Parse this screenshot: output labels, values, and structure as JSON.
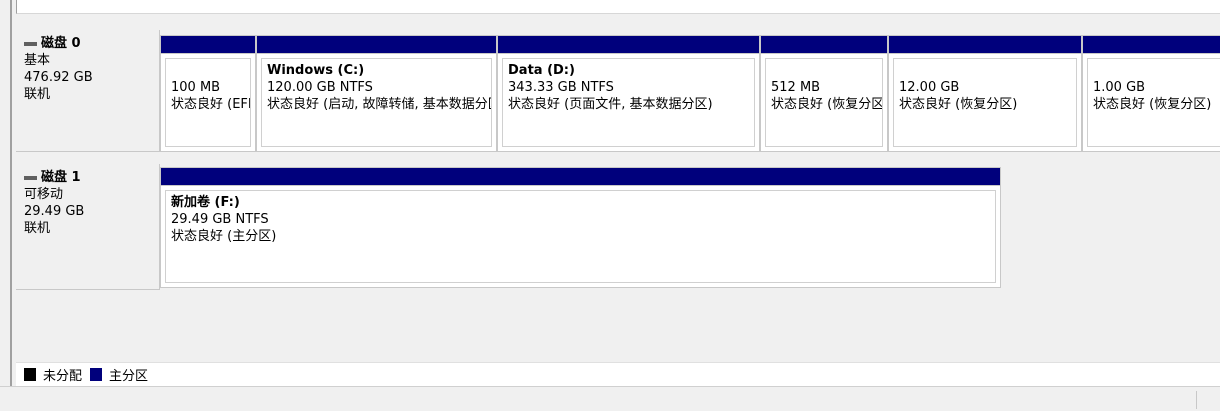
{
  "disks": [
    {
      "title": "磁盘 0",
      "type": "基本",
      "size": "476.92 GB",
      "status": "联机",
      "volumes": [
        {
          "name": "",
          "size": "100 MB",
          "status": "状态良好 (EFI 系统分区)"
        },
        {
          "name": "Windows  (C:)",
          "size": "120.00 GB NTFS",
          "status": "状态良好 (启动, 故障转储, 基本数据分区)"
        },
        {
          "name": "Data  (D:)",
          "size": "343.33 GB NTFS",
          "status": "状态良好 (页面文件, 基本数据分区)"
        },
        {
          "name": "",
          "size": "512 MB",
          "status": "状态良好 (恢复分区)"
        },
        {
          "name": "",
          "size": "12.00 GB",
          "status": "状态良好 (恢复分区)"
        },
        {
          "name": "",
          "size": "1.00 GB",
          "status": "状态良好 (恢复分区)"
        }
      ]
    },
    {
      "title": "磁盘 1",
      "type": "可移动",
      "size": "29.49 GB",
      "status": "联机",
      "volumes": [
        {
          "name": "新加卷  (F:)",
          "size": "29.49 GB NTFS",
          "status": "状态良好 (主分区)"
        }
      ]
    }
  ],
  "legend": {
    "unallocated": "未分配",
    "primary": "主分区",
    "unallocated_color": "#000000",
    "primary_color": "#00007c"
  },
  "colors": {
    "partition_bar": "#00007c",
    "background": "#f0f0f0"
  }
}
